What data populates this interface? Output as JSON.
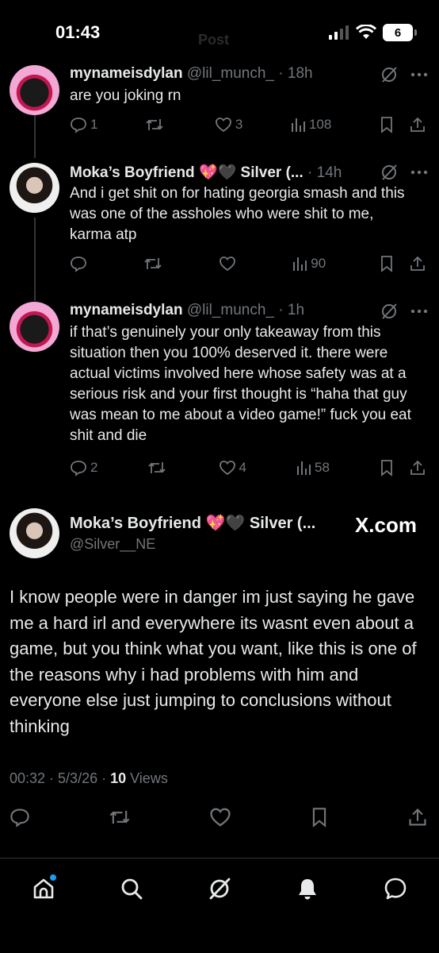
{
  "status_bar": {
    "time": "01:43",
    "faded_title": "Post",
    "battery": "6"
  },
  "tweets": [
    {
      "name": "mynameisdylan",
      "handle": "@lil_munch_",
      "time": "18h",
      "text": "are you joking rn",
      "replies": "1",
      "likes": "3",
      "views": "108"
    },
    {
      "name": "Moka’s Boyfriend 💖🖤 Silver (...",
      "handle": "",
      "time": "14h",
      "text": "And i get shit on for hating georgia smash and this was one of the assholes who were shit to me, karma atp",
      "replies": "",
      "likes": "",
      "views": "90"
    },
    {
      "name": "mynameisdylan",
      "handle": "@lil_munch_",
      "time": "1h",
      "text": "if that’s genuinely your only takeaway from this situation then you 100% deserved it. there were actual victims involved here whose safety was at a serious risk and your first thought is “haha that guy was mean to me about a video game!” fuck you eat shit and die",
      "replies": "2",
      "likes": "4",
      "views": "58"
    }
  ],
  "main_tweet": {
    "name": "Moka’s Boyfriend 💖🖤 Silver (...",
    "handle": "@Silver__NE",
    "watermark": "X.com",
    "text": "I know people were in danger im just saying he gave me a hard irl and everywhere its wasnt even about a game, but you think what you want, like this is one of the reasons why i had problems with him and everyone else just jumping to conclusions without thinking",
    "timestamp": "00:32 · 5/3/26 · ",
    "views_count": "10",
    "views_label": " Views"
  },
  "colors": {
    "accent": "#1d9bf0",
    "muted": "#71767b",
    "text": "#e7e9ea",
    "background": "#000000"
  },
  "bottom_nav": [
    "home-icon",
    "search-icon",
    "grok-icon",
    "notifications-icon",
    "messages-icon"
  ]
}
